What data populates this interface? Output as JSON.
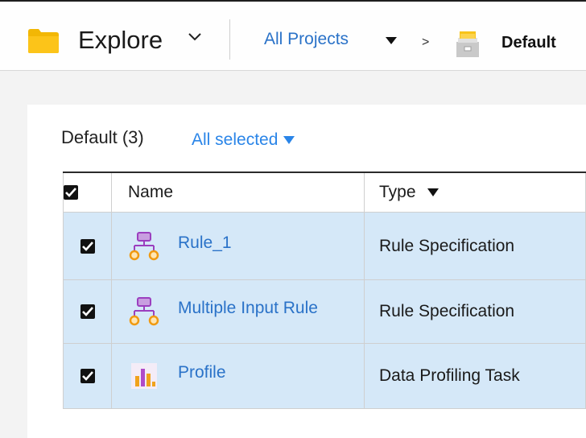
{
  "header": {
    "app_title": "Explore",
    "breadcrumb": {
      "projects_label": "All Projects",
      "separator": ">",
      "current": "Default"
    }
  },
  "panel": {
    "heading": "Default (3)",
    "selection_label": "All selected",
    "columns": {
      "name": "Name",
      "type": "Type"
    },
    "rows": [
      {
        "name": "Rule_1",
        "type": "Rule Specification",
        "icon": "rule-specification-icon",
        "checked": true
      },
      {
        "name": "Multiple Input Rule",
        "type": "Rule Specification",
        "icon": "rule-specification-icon",
        "checked": true
      },
      {
        "name": "Profile",
        "type": "Data Profiling Task",
        "icon": "data-profiling-icon",
        "checked": true
      }
    ]
  },
  "colors": {
    "link": "#2a72c8",
    "accent_link": "#2a85e8",
    "selected_row": "#d5e8f8",
    "folder": "#f7c31a",
    "rule_icon_top": "#b04bc9",
    "rule_icon_nodes": "#f0a21c"
  }
}
